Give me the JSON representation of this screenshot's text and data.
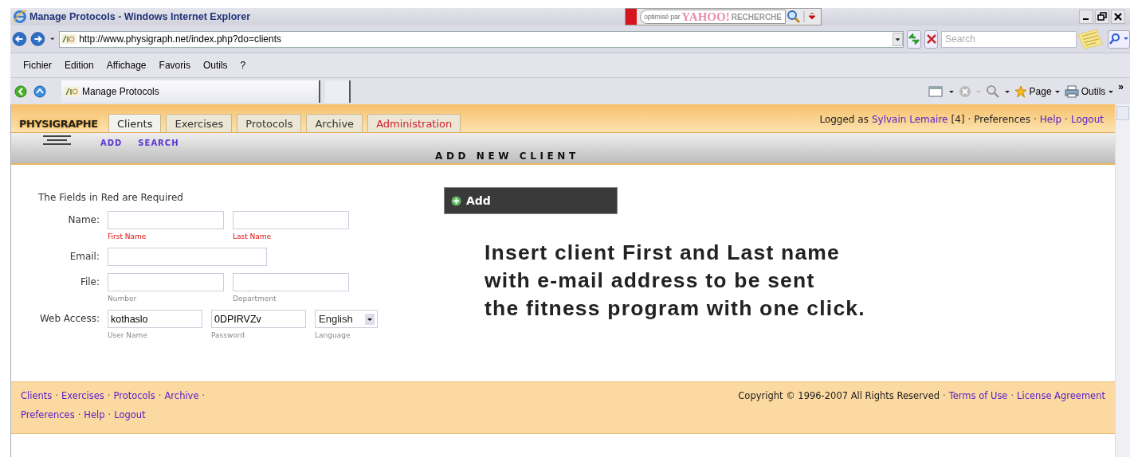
{
  "window": {
    "title": "Manage Protocols - Windows Internet Explorer"
  },
  "yahoo_toolbar": {
    "prefix": "optimisé par",
    "brand": "YAHOO!",
    "label": "RECHERCHE"
  },
  "address_bar": {
    "url": "http://www.physigraph.net/index.php?do=clients"
  },
  "search_box": {
    "placeholder": "Search"
  },
  "menu": [
    "Fichier",
    "Edition",
    "Affichage",
    "Favoris",
    "Outils",
    "?"
  ],
  "browser_tabs": [
    {
      "label": "Manage Protocols",
      "selected": true
    }
  ],
  "command_bar": {
    "items": [
      "Page",
      "Outils"
    ],
    "more": "»"
  },
  "site": {
    "logo": "PHYSIGRAPHE",
    "tabs": [
      {
        "label": "Clients",
        "selected": true,
        "kind": "normal"
      },
      {
        "label": "Exercises",
        "selected": false,
        "kind": "normal"
      },
      {
        "label": "Protocols",
        "selected": false,
        "kind": "normal"
      },
      {
        "label": "Archive",
        "selected": false,
        "kind": "normal"
      },
      {
        "label": "Administration",
        "selected": false,
        "kind": "admin"
      }
    ],
    "user_bar": {
      "prefix": "Logged as",
      "user": "Sylvain Lemaire",
      "count": "[4]",
      "separator": "·",
      "items": [
        {
          "label": "Preferences",
          "kind": "text"
        },
        {
          "label": "Help",
          "kind": "link"
        },
        {
          "label": "Logout",
          "kind": "link"
        }
      ]
    },
    "subnav": [
      "ADD",
      "SEARCH"
    ],
    "section_title": "ADD NEW CLIENT",
    "form": {
      "note": "The Fields in Red are Required",
      "rows": [
        {
          "label": "Name:",
          "fields": [
            {
              "kind": "text",
              "hint": "First Name",
              "required": true
            },
            {
              "kind": "text",
              "hint": "Last Name",
              "required": true
            }
          ]
        },
        {
          "label": "Email:",
          "fields": [
            {
              "kind": "text"
            }
          ]
        },
        {
          "label": "File:",
          "fields": [
            {
              "kind": "text",
              "hint": "Number",
              "required": false
            },
            {
              "kind": "text",
              "hint": "Department",
              "required": false
            }
          ]
        },
        {
          "label": "Web Access:",
          "fields": [
            {
              "kind": "text",
              "value": "kothaslo",
              "hint": "User Name",
              "required": false
            },
            {
              "kind": "text",
              "value": "0DPIRVZv",
              "hint": "Password",
              "required": false
            },
            {
              "kind": "select",
              "value": "English",
              "hint": "Language",
              "required": false
            }
          ]
        }
      ]
    },
    "add_panel": {
      "label": "Add"
    },
    "promo": [
      "Insert client First and Last name",
      "with e-mail address to be sent",
      "the fitness program with one click."
    ],
    "footer": {
      "separator": "·",
      "nav": [
        [
          "Clients",
          "Exercises",
          "Protocols",
          "Archive"
        ],
        [
          "Preferences",
          "Help",
          "Logout"
        ]
      ],
      "copyright": "Copyright © 1996-2007  All Rights Reserved",
      "links": [
        "Terms of Use",
        "License Agreement"
      ]
    }
  }
}
